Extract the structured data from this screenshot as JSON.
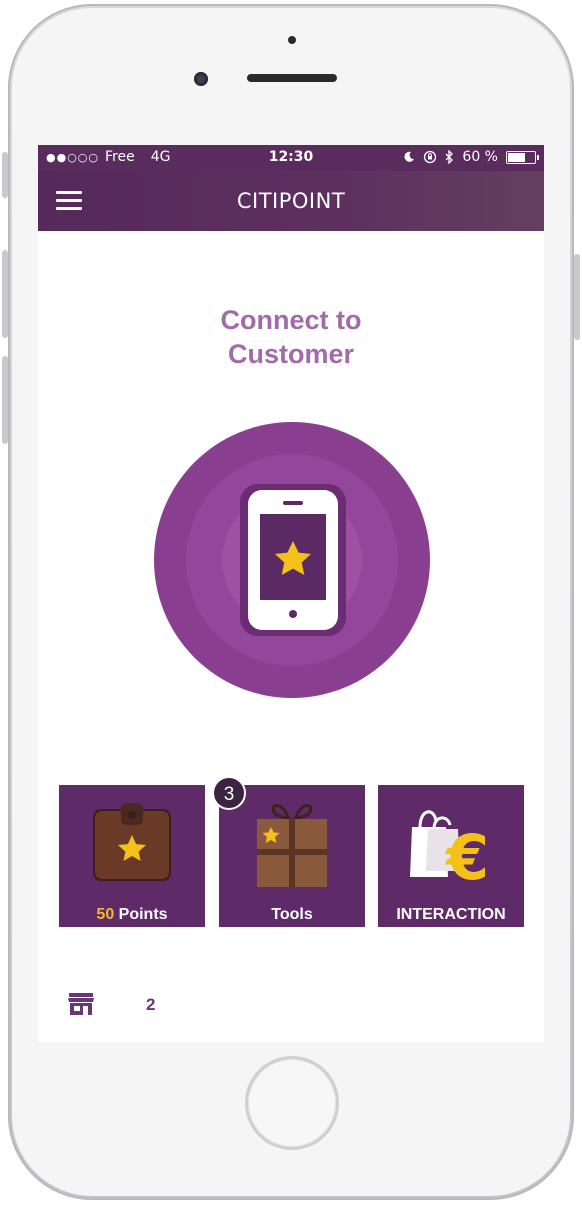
{
  "status_bar": {
    "signal": "●●○○○",
    "carrier": "Free",
    "network": "4G",
    "time": "12:30",
    "battery_percent": "60 %",
    "battery_level": 0.6
  },
  "nav": {
    "title": "CITIPOINT",
    "menu_icon": "hamburger-menu-icon"
  },
  "main": {
    "headline_line1": "Connect to",
    "headline_line2": "Customer",
    "connect_icon": "phone-star-icon"
  },
  "tiles": [
    {
      "label_num": "50",
      "label_text": " Points",
      "icon": "wallet-star-icon"
    },
    {
      "label": "Tools",
      "icon": "gift-box-star-icon",
      "badge": "3"
    },
    {
      "label": "INTERACTION",
      "icon": "shopping-bag-euro-icon"
    }
  ],
  "bottom_bar": {
    "store_icon": "store-icon",
    "count": "2"
  },
  "colors": {
    "brand_purple": "#5e2a68",
    "headline_purple": "#a16aaa",
    "accent_gold": "#f3b92a"
  }
}
